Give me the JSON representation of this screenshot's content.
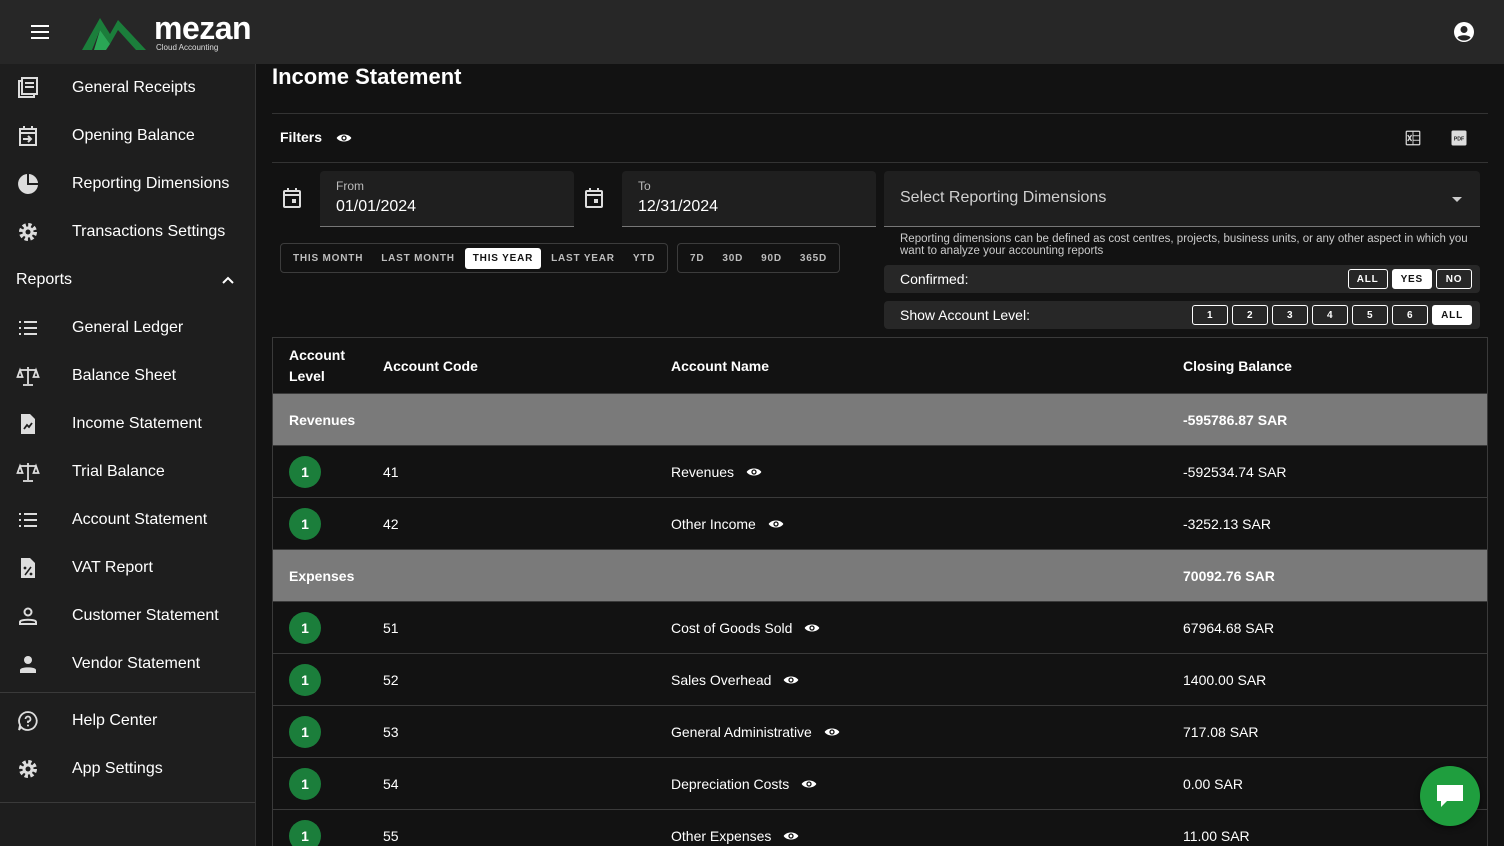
{
  "brand": {
    "name": "mezan",
    "tagline": "Cloud Accounting",
    "color": "#1b7e3b"
  },
  "sidebar": {
    "items_top": [
      {
        "label": "General Receipts",
        "icon": "receipt-list-icon"
      },
      {
        "label": "Opening Balance",
        "icon": "calendar-import-icon"
      },
      {
        "label": "Reporting Dimensions",
        "icon": "pie-chart-icon"
      },
      {
        "label": "Transactions Settings",
        "icon": "gear-icon"
      }
    ],
    "reports_label": "Reports",
    "reports_items": [
      {
        "label": "General Ledger",
        "icon": "list-icon"
      },
      {
        "label": "Balance Sheet",
        "icon": "scale-icon"
      },
      {
        "label": "Income Statement",
        "icon": "document-chart-icon"
      },
      {
        "label": "Trial Balance",
        "icon": "scale-icon"
      },
      {
        "label": "Account Statement",
        "icon": "list-icon"
      },
      {
        "label": "VAT Report",
        "icon": "percent-document-icon"
      },
      {
        "label": "Customer Statement",
        "icon": "person-outline-icon"
      },
      {
        "label": "Vendor Statement",
        "icon": "person-icon"
      }
    ],
    "bottom_items": [
      {
        "label": "Help Center",
        "icon": "help-chat-icon"
      },
      {
        "label": "App Settings",
        "icon": "gear-icon"
      }
    ]
  },
  "page": {
    "title": "Income Statement"
  },
  "filters": {
    "label": "Filters",
    "from_label": "From",
    "from_value": "01/01/2024",
    "to_label": "To",
    "to_value": "12/31/2024",
    "period_buttons": [
      "THIS MONTH",
      "LAST MONTH",
      "THIS YEAR",
      "LAST YEAR",
      "YTD"
    ],
    "period_active": "THIS YEAR",
    "range_buttons": [
      "7D",
      "30D",
      "90D",
      "365D"
    ],
    "dimensions_placeholder": "Select Reporting Dimensions",
    "dimensions_help": "Reporting dimensions can be defined as cost centres, projects, business units, or any other aspect in which you want to analyze your accounting reports",
    "confirmed_label": "Confirmed:",
    "confirmed_options": [
      "ALL",
      "YES",
      "NO"
    ],
    "confirmed_active": "YES",
    "level_label": "Show Account Level:",
    "level_options": [
      "1",
      "2",
      "3",
      "4",
      "5",
      "6",
      "ALL"
    ],
    "level_active": "ALL"
  },
  "table": {
    "headers": {
      "level": "Account Level",
      "code": "Account Code",
      "name": "Account Name",
      "balance": "Closing Balance"
    },
    "groups": [
      {
        "name": "Revenues",
        "total": "-595786.87 SAR",
        "rows": [
          {
            "level": "1",
            "code": "41",
            "name": "Revenues",
            "balance": "-592534.74 SAR"
          },
          {
            "level": "1",
            "code": "42",
            "name": "Other Income",
            "balance": "-3252.13 SAR"
          }
        ]
      },
      {
        "name": "Expenses",
        "total": "70092.76 SAR",
        "rows": [
          {
            "level": "1",
            "code": "51",
            "name": "Cost of Goods Sold",
            "balance": "67964.68 SAR"
          },
          {
            "level": "1",
            "code": "52",
            "name": "Sales Overhead",
            "balance": "1400.00 SAR"
          },
          {
            "level": "1",
            "code": "53",
            "name": "General Administrative",
            "balance": "717.08 SAR"
          },
          {
            "level": "1",
            "code": "54",
            "name": "Depreciation Costs",
            "balance": "0.00 SAR"
          },
          {
            "level": "1",
            "code": "55",
            "name": "Other Expenses",
            "balance": "11.00 SAR"
          }
        ]
      }
    ]
  }
}
